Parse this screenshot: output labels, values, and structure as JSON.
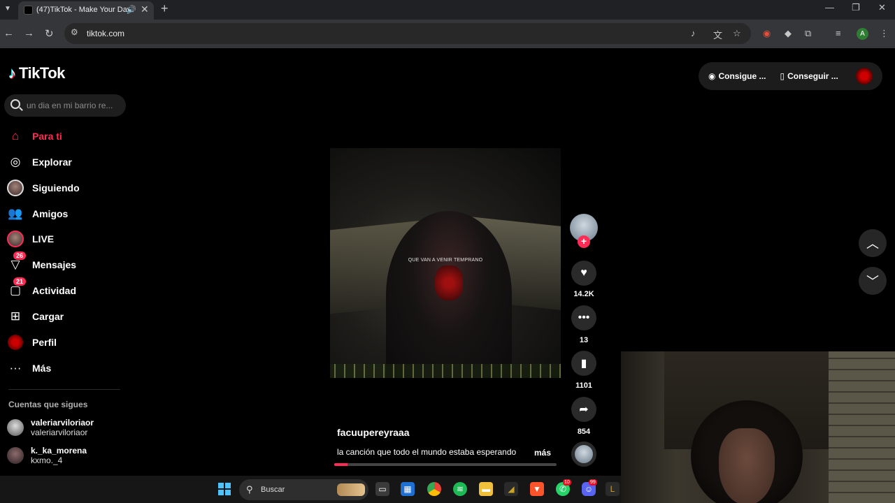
{
  "browser": {
    "tab_title": "(47)TikTok - Make Your Day",
    "url": "tiktok.com",
    "tab_audio_icon": "speaker-icon",
    "window_controls": [
      "minimize",
      "restore",
      "close"
    ],
    "profile_initial": "A"
  },
  "tiktok": {
    "logo_text": "TikTok",
    "search_placeholder": "un dia en mi barrio re...",
    "nav": [
      {
        "label": "Para ti",
        "icon": "home-icon",
        "active": true
      },
      {
        "label": "Explorar",
        "icon": "compass-icon"
      },
      {
        "label": "Siguiendo",
        "icon": "following-avatar"
      },
      {
        "label": "Amigos",
        "icon": "friends-icon"
      },
      {
        "label": "LIVE",
        "icon": "live-avatar"
      },
      {
        "label": "Mensajes",
        "icon": "messages-icon",
        "badge": "26"
      },
      {
        "label": "Actividad",
        "icon": "activity-icon",
        "badge": "21"
      },
      {
        "label": "Cargar",
        "icon": "upload-icon"
      },
      {
        "label": "Perfil",
        "icon": "profile-avatar"
      },
      {
        "label": "Más",
        "icon": "more-icon"
      }
    ],
    "following_title": "Cuentas que sigues",
    "following": [
      {
        "name": "valeriarviloriaor",
        "handle": "valeriarviloriaor"
      },
      {
        "name": "k._ka_morena",
        "handle": "kxmo._4"
      }
    ],
    "top_right": {
      "coins_label": "Consigue ...",
      "app_label": "Conseguir ..."
    },
    "video": {
      "overlay_text": "QUE VAN A VENIR TEMPRANO",
      "author": "facuupereyraaa",
      "description": "la canción que todo el mundo estaba esperando",
      "more_label": "más",
      "progress": 0.06
    },
    "actions": {
      "likes": "14.2K",
      "comments": "13",
      "saves": "1101",
      "shares": "854"
    }
  },
  "taskbar": {
    "search_label": "Buscar",
    "whatsapp_badge": "10",
    "discord_badge": "99"
  },
  "colors": {
    "accent": "#fe2c55",
    "background": "#000000"
  }
}
